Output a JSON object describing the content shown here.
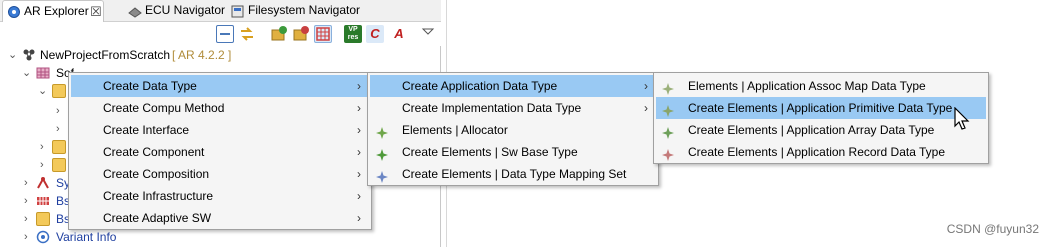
{
  "tabs": [
    {
      "label": "AR Explorer",
      "close": "☒",
      "active": true
    },
    {
      "label": "ECU Navigator",
      "active": false
    },
    {
      "label": "Filesystem Navigator",
      "active": false
    }
  ],
  "toolbar": {
    "vp_res_label": "VP\nres",
    "c_label": "C",
    "a_label": "A"
  },
  "tree": {
    "project_name": "NewProjectFromScratch",
    "project_version": "[ AR 4.2.2 ]",
    "node_software": "Sof",
    "node_sy": "Sy",
    "node_bs1": "Bs",
    "node_bs2": "Bs",
    "node_variant": "Variant Info"
  },
  "menu1": {
    "items": [
      {
        "label": "Create Data Type",
        "arrow": "›",
        "highlighted": true
      },
      {
        "label": "Create Compu Method",
        "arrow": "›"
      },
      {
        "label": "Create Interface",
        "arrow": "›"
      },
      {
        "label": "Create Component",
        "arrow": "›"
      },
      {
        "label": "Create Composition",
        "arrow": "›"
      },
      {
        "label": "Create Infrastructure",
        "arrow": "›"
      },
      {
        "label": "Create Adaptive SW",
        "arrow": "›"
      }
    ]
  },
  "menu2": {
    "items": [
      {
        "label": "Create Application Data Type",
        "arrow": "›",
        "highlighted": true
      },
      {
        "label": "Create Implementation Data Type",
        "arrow": "›"
      },
      {
        "label": "Elements | Allocator",
        "icon_color": "#6fa64a"
      },
      {
        "label": "Create Elements | Sw Base Type",
        "icon_color": "#4f9a3a"
      },
      {
        "label": "Create Elements | Data Type Mapping Set",
        "icon_color": "#6b86c4"
      }
    ]
  },
  "menu3": {
    "items": [
      {
        "label": "Elements | Application Assoc Map Data Type",
        "icon_color": "#9bb07a"
      },
      {
        "label": "Create Elements | Application Primitive Data Type",
        "icon_color": "#8aa56a",
        "highlighted": true
      },
      {
        "label": "Create Elements | Application Array Data Type",
        "icon_color": "#6ea05a"
      },
      {
        "label": "Create Elements | Application Record Data Type",
        "icon_color": "#c47a7a"
      }
    ]
  },
  "watermark": "CSDN @fuyun32",
  "colors": {
    "highlight": "#99c9f3",
    "menu_bg": "#f5f5f5"
  }
}
